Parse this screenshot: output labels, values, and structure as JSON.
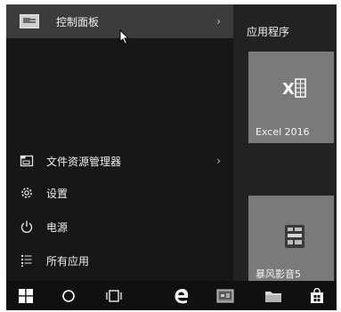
{
  "start_menu": {
    "items": [
      {
        "label": "控制面板",
        "chevron": "›",
        "icon": "control-panel-icon"
      },
      {
        "label": "文件资源管理器",
        "chevron": "›",
        "icon": "file-explorer-icon"
      },
      {
        "label": "设置",
        "icon": "gear-icon"
      },
      {
        "label": "电源",
        "icon": "power-icon"
      },
      {
        "label": "所有应用",
        "icon": "all-apps-icon"
      }
    ]
  },
  "tiles": {
    "group_title": "应用程序",
    "items": [
      {
        "label": "Excel 2016",
        "icon": "excel-icon"
      },
      {
        "label": "暴风影音5",
        "icon": "storm-player-icon"
      }
    ]
  },
  "taskbar": {
    "buttons": [
      {
        "icon": "windows-logo-icon"
      },
      {
        "icon": "cortana-icon"
      },
      {
        "icon": "task-view-icon"
      },
      {
        "icon": "edge-icon"
      },
      {
        "icon": "app-icon"
      },
      {
        "icon": "file-explorer-icon"
      },
      {
        "icon": "store-icon"
      }
    ]
  },
  "colors": {
    "menu_background": "#171717",
    "selected_item": "#3c3c3c",
    "tile_background": "#7a7a7a",
    "taskbar_background": "#101010"
  }
}
